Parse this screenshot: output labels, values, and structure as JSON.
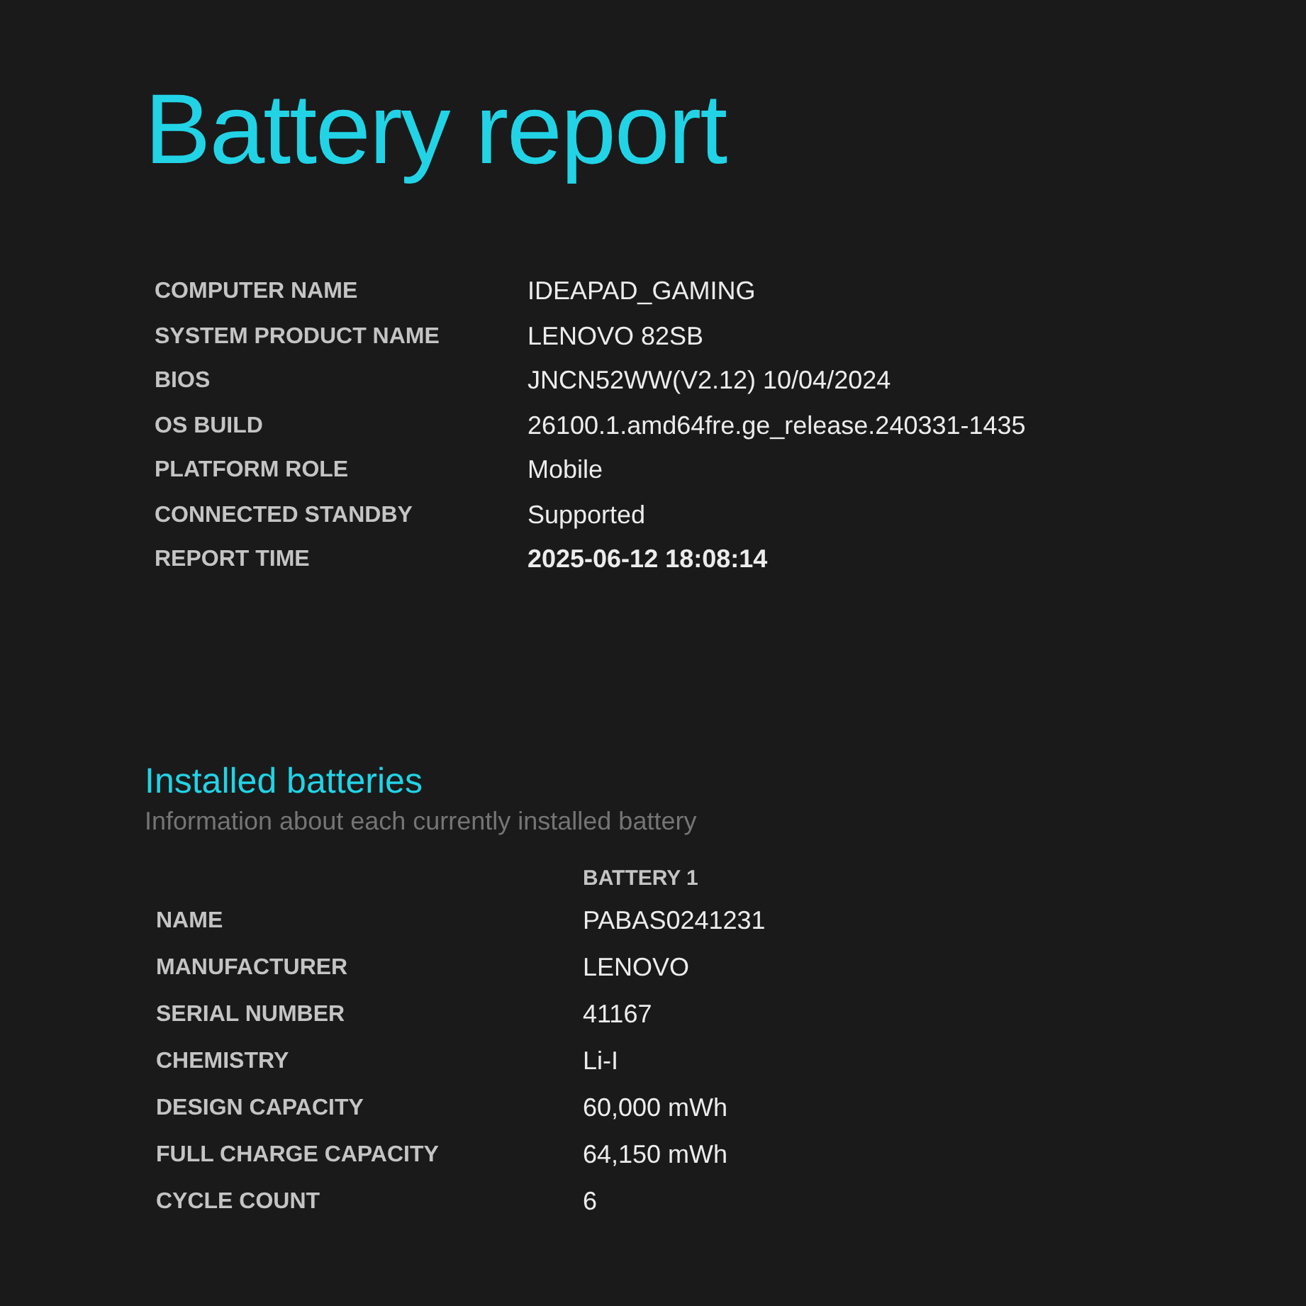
{
  "title": "Battery report",
  "system_info": [
    {
      "label": "COMPUTER NAME",
      "value": "IDEAPAD_GAMING",
      "bold": false
    },
    {
      "label": "SYSTEM PRODUCT NAME",
      "value": "LENOVO 82SB",
      "bold": false
    },
    {
      "label": "BIOS",
      "value": "JNCN52WW(V2.12) 10/04/2024",
      "bold": false
    },
    {
      "label": "OS BUILD",
      "value": "26100.1.amd64fre.ge_release.240331-1435",
      "bold": false
    },
    {
      "label": "PLATFORM ROLE",
      "value": "Mobile",
      "bold": false
    },
    {
      "label": "CONNECTED STANDBY",
      "value": "Supported",
      "bold": false
    },
    {
      "label": "REPORT TIME",
      "value": "2025-06-12  18:08:14",
      "bold": true
    }
  ],
  "installed_batteries": {
    "heading": "Installed batteries",
    "subtitle": "Information about each currently installed battery",
    "column_header": "BATTERY 1",
    "rows": [
      {
        "label": "NAME",
        "value": "PABAS0241231"
      },
      {
        "label": "MANUFACTURER",
        "value": "LENOVO"
      },
      {
        "label": "SERIAL NUMBER",
        "value": "41167"
      },
      {
        "label": "CHEMISTRY",
        "value": "Li-I"
      },
      {
        "label": "DESIGN CAPACITY",
        "value": "60,000 mWh"
      },
      {
        "label": "FULL CHARGE CAPACITY",
        "value": "64,150 mWh"
      },
      {
        "label": "CYCLE COUNT",
        "value": "6"
      }
    ]
  }
}
